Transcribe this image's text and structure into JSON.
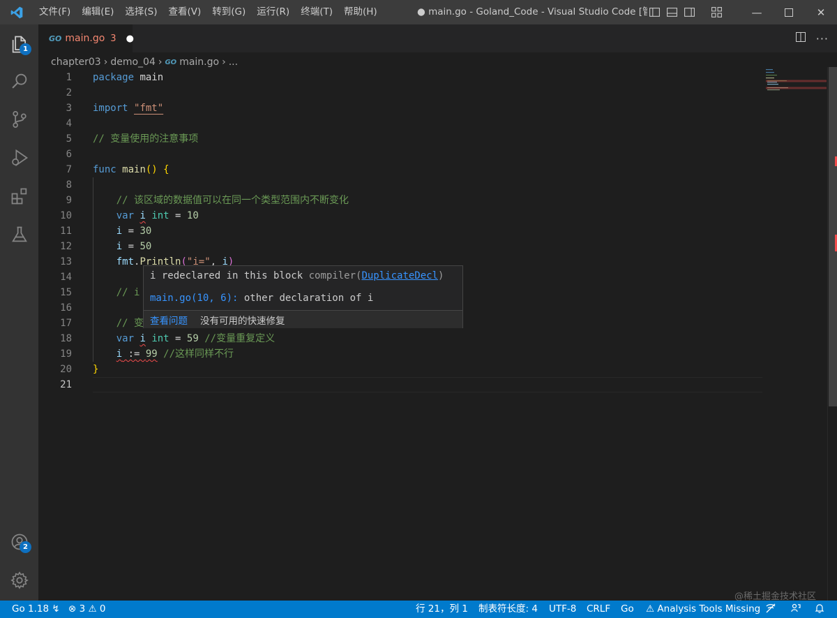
{
  "titlebar": {
    "menu": [
      "文件(F)",
      "编辑(E)",
      "选择(S)",
      "查看(V)",
      "转到(G)",
      "运行(R)",
      "终端(T)",
      "帮助(H)"
    ],
    "window_title": "● main.go - Goland_Code - Visual Studio Code [管理..."
  },
  "activity": {
    "explorer_badge": "1",
    "accounts_badge": "2"
  },
  "tab": {
    "icon": "GO",
    "name": "main.go",
    "problem_count": "3",
    "dirty_dot": "●"
  },
  "breadcrumb": {
    "items": [
      "chapter03",
      "demo_04",
      "main.go",
      "..."
    ],
    "file_icon": "GO"
  },
  "editor": {
    "line_numbers": [
      "1",
      "2",
      "3",
      "4",
      "5",
      "6",
      "7",
      "8",
      "9",
      "10",
      "11",
      "12",
      "13",
      "14",
      "15",
      "16",
      "17",
      "18",
      "19",
      "20",
      "21"
    ],
    "lines": [
      {
        "t": [
          [
            "kw",
            "package"
          ],
          [
            "txt",
            " main"
          ]
        ]
      },
      {
        "t": []
      },
      {
        "t": [
          [
            "kw",
            "import"
          ],
          [
            "txt",
            " "
          ],
          [
            "str",
            "\"fmt\""
          ]
        ]
      },
      {
        "t": []
      },
      {
        "t": [
          [
            "cmt",
            "// 变量使用的注意事项"
          ]
        ]
      },
      {
        "t": []
      },
      {
        "t": [
          [
            "kw",
            "func"
          ],
          [
            "txt",
            " "
          ],
          [
            "fn",
            "main"
          ],
          [
            "brace",
            "()"
          ],
          [
            "txt",
            " "
          ],
          [
            "brace",
            "{"
          ]
        ]
      },
      {
        "t": []
      },
      {
        "t": [
          [
            "txt",
            "    "
          ],
          [
            "cmt",
            "// 该区域的数据值可以在同一个类型范围内不断变化"
          ]
        ]
      },
      {
        "t": [
          [
            "txt",
            "    "
          ],
          [
            "kw",
            "var"
          ],
          [
            "txt",
            " "
          ],
          [
            "var",
            "i"
          ],
          [
            "txt",
            " "
          ],
          [
            "typ",
            "int"
          ],
          [
            "txt",
            " = "
          ],
          [
            "num",
            "10"
          ]
        ]
      },
      {
        "t": [
          [
            "txt",
            "    "
          ],
          [
            "var",
            "i"
          ],
          [
            "txt",
            " = "
          ],
          [
            "num",
            "30"
          ]
        ]
      },
      {
        "t": [
          [
            "txt",
            "    "
          ],
          [
            "var",
            "i"
          ],
          [
            "txt",
            " = "
          ],
          [
            "num",
            "50"
          ]
        ]
      },
      {
        "t": [
          [
            "txt",
            "    "
          ],
          [
            "var",
            "fmt"
          ],
          [
            "txt",
            "."
          ],
          [
            "fn",
            "Println"
          ],
          [
            "paren",
            "("
          ],
          [
            "str",
            "\"i=\""
          ],
          [
            "txt",
            ", "
          ],
          [
            "var",
            "i"
          ],
          [
            "paren",
            ")"
          ]
        ]
      },
      {
        "t": []
      },
      {
        "t": [
          [
            "txt",
            "    "
          ],
          [
            "cmt",
            "// i"
          ]
        ]
      },
      {
        "t": []
      },
      {
        "t": [
          [
            "txt",
            "    "
          ],
          [
            "cmt",
            "// 变"
          ]
        ]
      },
      {
        "t": [
          [
            "txt",
            "    "
          ],
          [
            "kw",
            "var"
          ],
          [
            "txt",
            " "
          ],
          [
            "var",
            "i"
          ],
          [
            "txt",
            " "
          ],
          [
            "typ",
            "int"
          ],
          [
            "txt",
            " = "
          ],
          [
            "num",
            "59"
          ],
          [
            "txt",
            " "
          ],
          [
            "cmt",
            "//变量重复定义"
          ]
        ]
      },
      {
        "t": [
          [
            "txt",
            "    "
          ],
          [
            "var",
            "i"
          ],
          [
            "txt",
            " := "
          ],
          [
            "num",
            "99"
          ],
          [
            "txt",
            " "
          ],
          [
            "cmt",
            "//这样同样不行"
          ]
        ]
      },
      {
        "t": [
          [
            "brace",
            "}"
          ]
        ]
      },
      {
        "t": []
      }
    ]
  },
  "hover": {
    "message": "i redeclared in this block",
    "source": "compiler(",
    "code": "DuplicateDecl",
    "source_end": ")",
    "related_location": "main.go(10, 6):",
    "related_message": " other declaration of i",
    "view_problem": "查看问题",
    "no_quick_fix": "没有可用的快速修复"
  },
  "statusbar": {
    "go_version": "Go 1.18",
    "errors": "3",
    "warnings": "0",
    "position": "行 21，列 1",
    "tab_size": "制表符长度: 4",
    "encoding": "UTF-8",
    "eol": "CRLF",
    "language": "Go",
    "analysis": "Analysis Tools Missing"
  },
  "watermark": "@稀土掘金技术社区",
  "colors": {
    "accent": "#007acc",
    "error": "#f14c4c"
  }
}
